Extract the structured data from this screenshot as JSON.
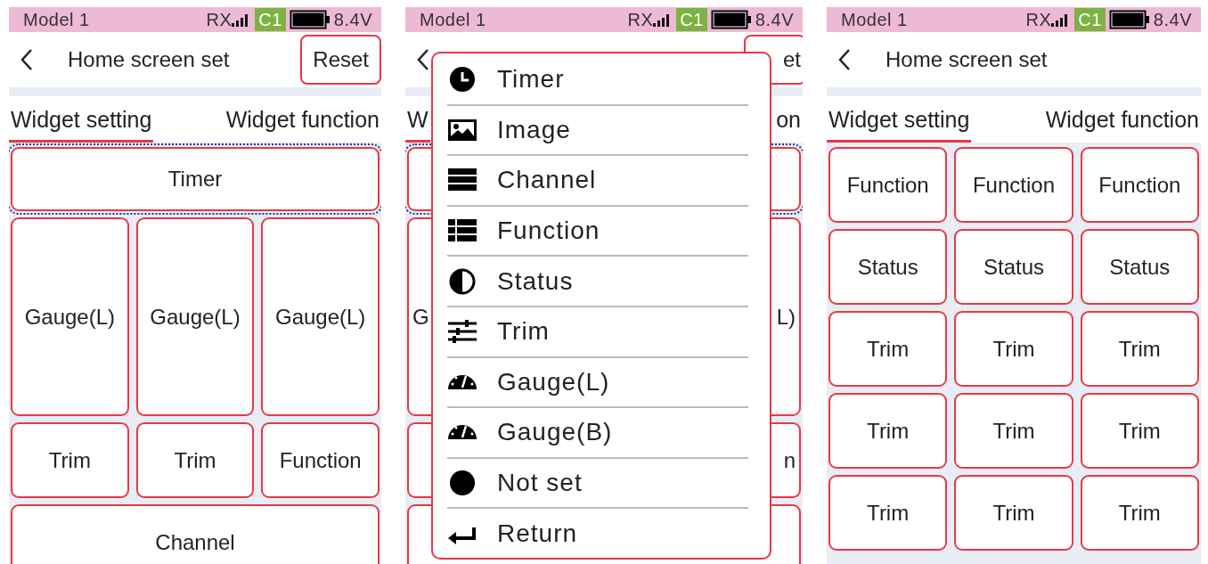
{
  "screens": [
    {
      "kind": "grid",
      "status": {
        "model": "Model 1",
        "rx": "RX",
        "channel": "C1",
        "voltage": "8.4V"
      },
      "header": {
        "title": "Home screen set",
        "reset": "Reset"
      },
      "tabs": [
        {
          "label": "Widget setting",
          "selected": true
        },
        {
          "label": "Widget function",
          "selected": false
        }
      ],
      "rows": [
        {
          "kind": "short",
          "cells": [
            {
              "label": "Timer",
              "selected": true
            }
          ]
        },
        {
          "kind": "tall",
          "cells": [
            {
              "label": "Gauge(L)",
              "selected": false
            },
            {
              "label": "Gauge(L)",
              "selected": false
            },
            {
              "label": "Gauge(L)",
              "selected": false
            }
          ]
        },
        {
          "kind": "normal",
          "cells": [
            {
              "label": "Trim",
              "selected": false
            },
            {
              "label": "Trim",
              "selected": false
            },
            {
              "label": "Function",
              "selected": false
            }
          ]
        },
        {
          "kind": "normal",
          "cells": [
            {
              "label": "Channel",
              "selected": false
            }
          ]
        }
      ]
    },
    {
      "kind": "menu-open",
      "status": {
        "model": "Model 1",
        "rx": "RX",
        "channel": "C1",
        "voltage": "8.4V"
      },
      "header": {
        "reset": "et"
      },
      "tabs": [
        {
          "label": "W",
          "selected": true
        },
        {
          "label": "on",
          "selected": false
        }
      ],
      "rows": [
        {
          "kind": "short",
          "cells": [
            {
              "selected": true
            }
          ]
        },
        {
          "kind": "tall",
          "cells": [
            {
              "label": "G",
              "selected": false
            },
            {
              "label": "L)",
              "selected": false
            }
          ]
        },
        {
          "kind": "normal",
          "cells": [
            {
              "selected": false
            },
            {
              "label": "n",
              "selected": false
            }
          ]
        },
        {
          "kind": "normal",
          "cells": [
            {
              "selected": false
            }
          ]
        }
      ],
      "menu": [
        {
          "kind": "clock",
          "label": "Timer"
        },
        {
          "kind": "image",
          "label": "Image"
        },
        {
          "kind": "channel",
          "label": "Channel"
        },
        {
          "kind": "function",
          "label": "Function"
        },
        {
          "kind": "status",
          "label": "Status"
        },
        {
          "kind": "trim",
          "label": "Trim"
        },
        {
          "kind": "gauge",
          "label": "Gauge(L)"
        },
        {
          "kind": "gauge",
          "label": "Gauge(B)"
        },
        {
          "kind": "dot",
          "label": "Not set"
        },
        {
          "kind": "return",
          "label": "Return"
        }
      ]
    },
    {
      "kind": "grid",
      "status": {
        "model": "Model 1",
        "rx": "RX",
        "channel": "C1",
        "voltage": "8.4V"
      },
      "header": {
        "title": "Home screen set"
      },
      "tabs": [
        {
          "label": "Widget setting",
          "selected": true
        },
        {
          "label": "Widget function",
          "selected": false
        }
      ],
      "rows": [
        {
          "kind": "normal",
          "cells": [
            {
              "label": "Function",
              "selected": false
            },
            {
              "label": "Function",
              "selected": false
            },
            {
              "label": "Function",
              "selected": false
            }
          ]
        },
        {
          "kind": "normal",
          "cells": [
            {
              "label": "Status",
              "selected": false
            },
            {
              "label": "Status",
              "selected": false
            },
            {
              "label": "Status",
              "selected": false
            }
          ]
        },
        {
          "kind": "normal",
          "cells": [
            {
              "label": "Trim",
              "selected": false
            },
            {
              "label": "Trim",
              "selected": false
            },
            {
              "label": "Trim",
              "selected": false
            }
          ]
        },
        {
          "kind": "normal",
          "cells": [
            {
              "label": "Trim",
              "selected": false
            },
            {
              "label": "Trim",
              "selected": false
            },
            {
              "label": "Trim",
              "selected": false
            }
          ]
        },
        {
          "kind": "normal",
          "cells": [
            {
              "label": "Trim",
              "selected": false
            },
            {
              "label": "Trim",
              "selected": false
            },
            {
              "label": "Trim",
              "selected": false
            }
          ]
        }
      ]
    }
  ]
}
